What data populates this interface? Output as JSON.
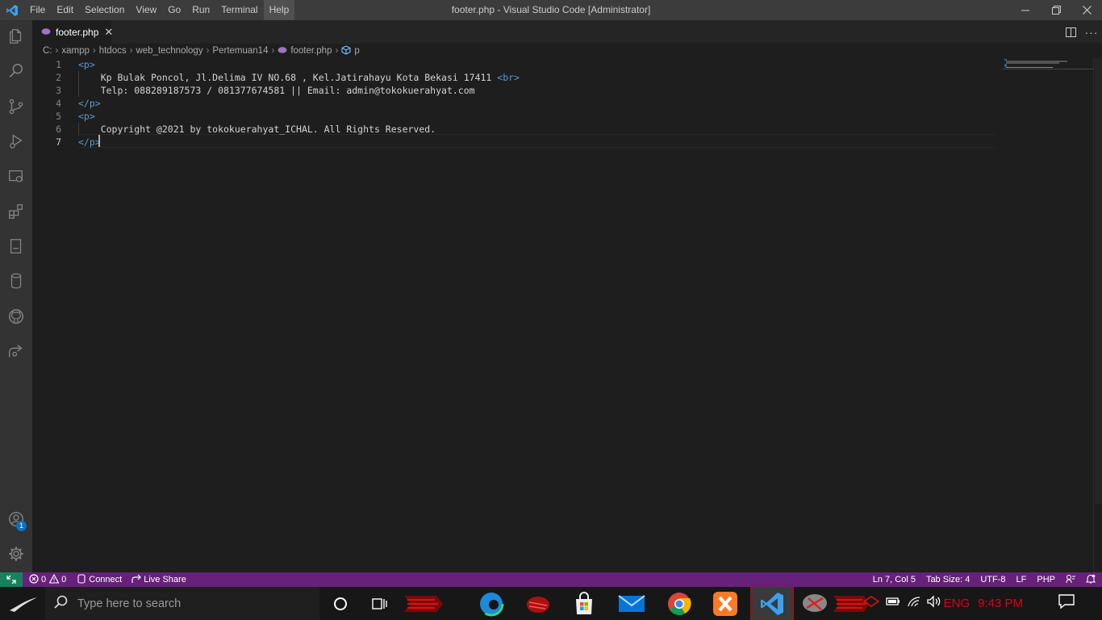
{
  "titlebar": {
    "menu": [
      "File",
      "Edit",
      "Selection",
      "View",
      "Go",
      "Run",
      "Terminal",
      "Help"
    ],
    "active_menu_index": 7,
    "window_title": "footer.php - Visual Studio Code [Administrator]"
  },
  "tab": {
    "label": "footer.php"
  },
  "breadcrumbs": [
    "C:",
    "xampp",
    "htdocs",
    "web_technology",
    "Pertemuan14",
    "footer.php",
    "p"
  ],
  "editor": {
    "line_numbers": [
      "1",
      "2",
      "3",
      "4",
      "5",
      "6",
      "7"
    ],
    "current_line": 7,
    "lines": [
      [
        {
          "t": "<p>",
          "c": "tag"
        }
      ],
      [
        {
          "t": "    Kp Bulak Poncol, Jl.Delima IV NO.68 , Kel.Jatirahayu Kota Bekasi 17411 ",
          "c": "txt"
        },
        {
          "t": "<br>",
          "c": "tag"
        }
      ],
      [
        {
          "t": "    Telp: 088289187573 / 081377674581 || Email: admin@tokokuerahyat.com",
          "c": "txt"
        }
      ],
      [
        {
          "t": "</p>",
          "c": "tag"
        }
      ],
      [
        {
          "t": "<p>",
          "c": "tag"
        }
      ],
      [
        {
          "t": "    Copyright @2021 by tokokuerahyat_ICHAL. All Rights Reserved.",
          "c": "txt"
        }
      ],
      [
        {
          "t": "</p>",
          "c": "tag"
        }
      ]
    ]
  },
  "statusbar": {
    "errors": "0",
    "warnings": "0",
    "connect": "Connect",
    "live_share": "Live Share",
    "position": "Ln 7, Col 5",
    "tab_size": "Tab Size: 4",
    "encoding": "UTF-8",
    "eol": "LF",
    "language": "PHP"
  },
  "accounts_badge": "1",
  "taskbar": {
    "search_placeholder": "Type here to search",
    "language": "ENG",
    "time": "9:43 PM"
  },
  "colors": {
    "statusbar": "#68217a",
    "remote": "#16825d",
    "tag": "#569cd6",
    "tray_text": "#e0001a"
  }
}
